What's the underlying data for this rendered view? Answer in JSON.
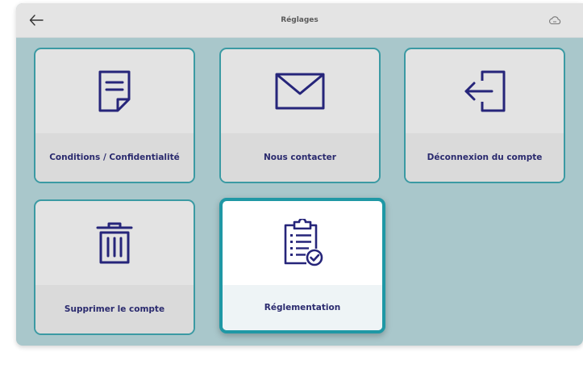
{
  "header": {
    "title": "Réglages",
    "back_icon": "arrow-left-icon",
    "status_icon": "cloud-icon"
  },
  "tiles": [
    {
      "label": "Conditions / Confidentialité",
      "icon": "document-icon"
    },
    {
      "label": "Nous contacter",
      "icon": "envelope-icon"
    },
    {
      "label": "Déconnexion du compte",
      "icon": "logout-icon"
    },
    {
      "label": "Supprimer le compte",
      "icon": "trash-icon"
    },
    {
      "label": "Réglementation",
      "icon": "clipboard-check-icon",
      "selected": true
    }
  ],
  "colors": {
    "background": "#a9c7cb",
    "tile_border": "#3b9aa3",
    "icon": "#26257a",
    "label": "#2a2a6e"
  }
}
